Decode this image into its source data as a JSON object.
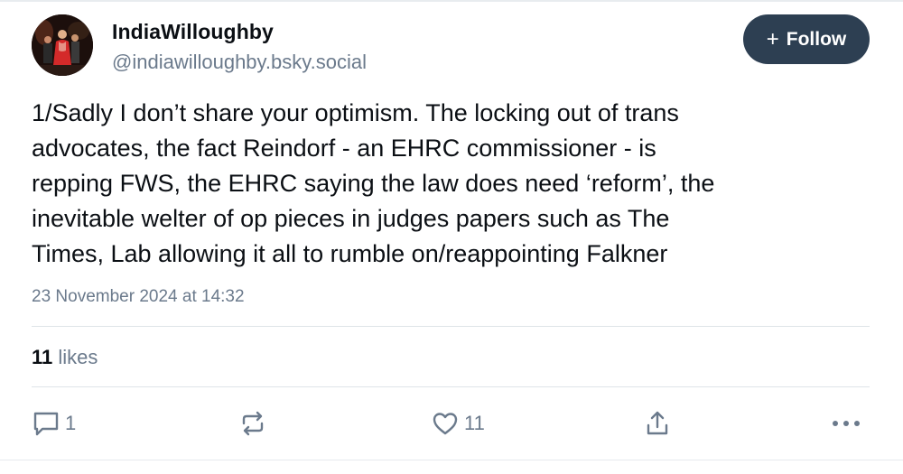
{
  "author": {
    "display_name": "IndiaWilloughby",
    "handle": "@indiawilloughby.bsky.social"
  },
  "follow_button": {
    "icon": "plus-icon",
    "label": "Follow"
  },
  "post": {
    "lines": [
      "1/Sadly I don’t share your optimism. The locking out of trans",
      "advocates, the fact Reindorf - an EHRC commissioner - is",
      "repping FWS, the EHRC saying the law does need ‘reform’, the",
      "inevitable welter of op pieces in judges papers such as The",
      "Times, Lab allowing it all to rumble on/reappointing Falkner"
    ],
    "timestamp": "23 November 2024 at 14:32"
  },
  "stats": {
    "likes_count": "11",
    "likes_label": "likes"
  },
  "actions": {
    "reply_count": "1",
    "repost_count": "",
    "like_count": "11"
  },
  "colors": {
    "accent_button": "#2d3f52",
    "muted_text": "#6b7a8c",
    "body_text": "#0b0f14"
  }
}
